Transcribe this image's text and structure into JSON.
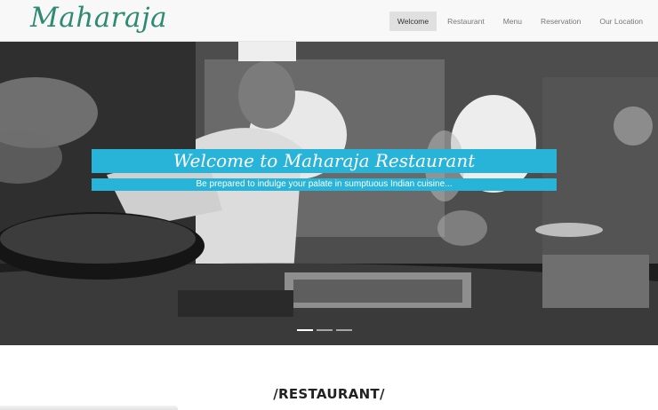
{
  "brand": {
    "name": "Maharaja",
    "color": "#2e8b72"
  },
  "nav": {
    "items": [
      {
        "label": "Welcome",
        "active": true
      },
      {
        "label": "Restaurant",
        "active": false
      },
      {
        "label": "Menu",
        "active": false
      },
      {
        "label": "Reservation",
        "active": false
      },
      {
        "label": "Our Location",
        "active": false
      }
    ]
  },
  "hero": {
    "title": "Welcome to Maharaja Restaurant",
    "subtitle": "Be prepared to indulge your palate in sumptuous Indian cuisine...",
    "caption_color": "#27b4d8",
    "slide_count": 3,
    "active_slide": 1
  },
  "section": {
    "title": "/RESTAURANT/"
  }
}
